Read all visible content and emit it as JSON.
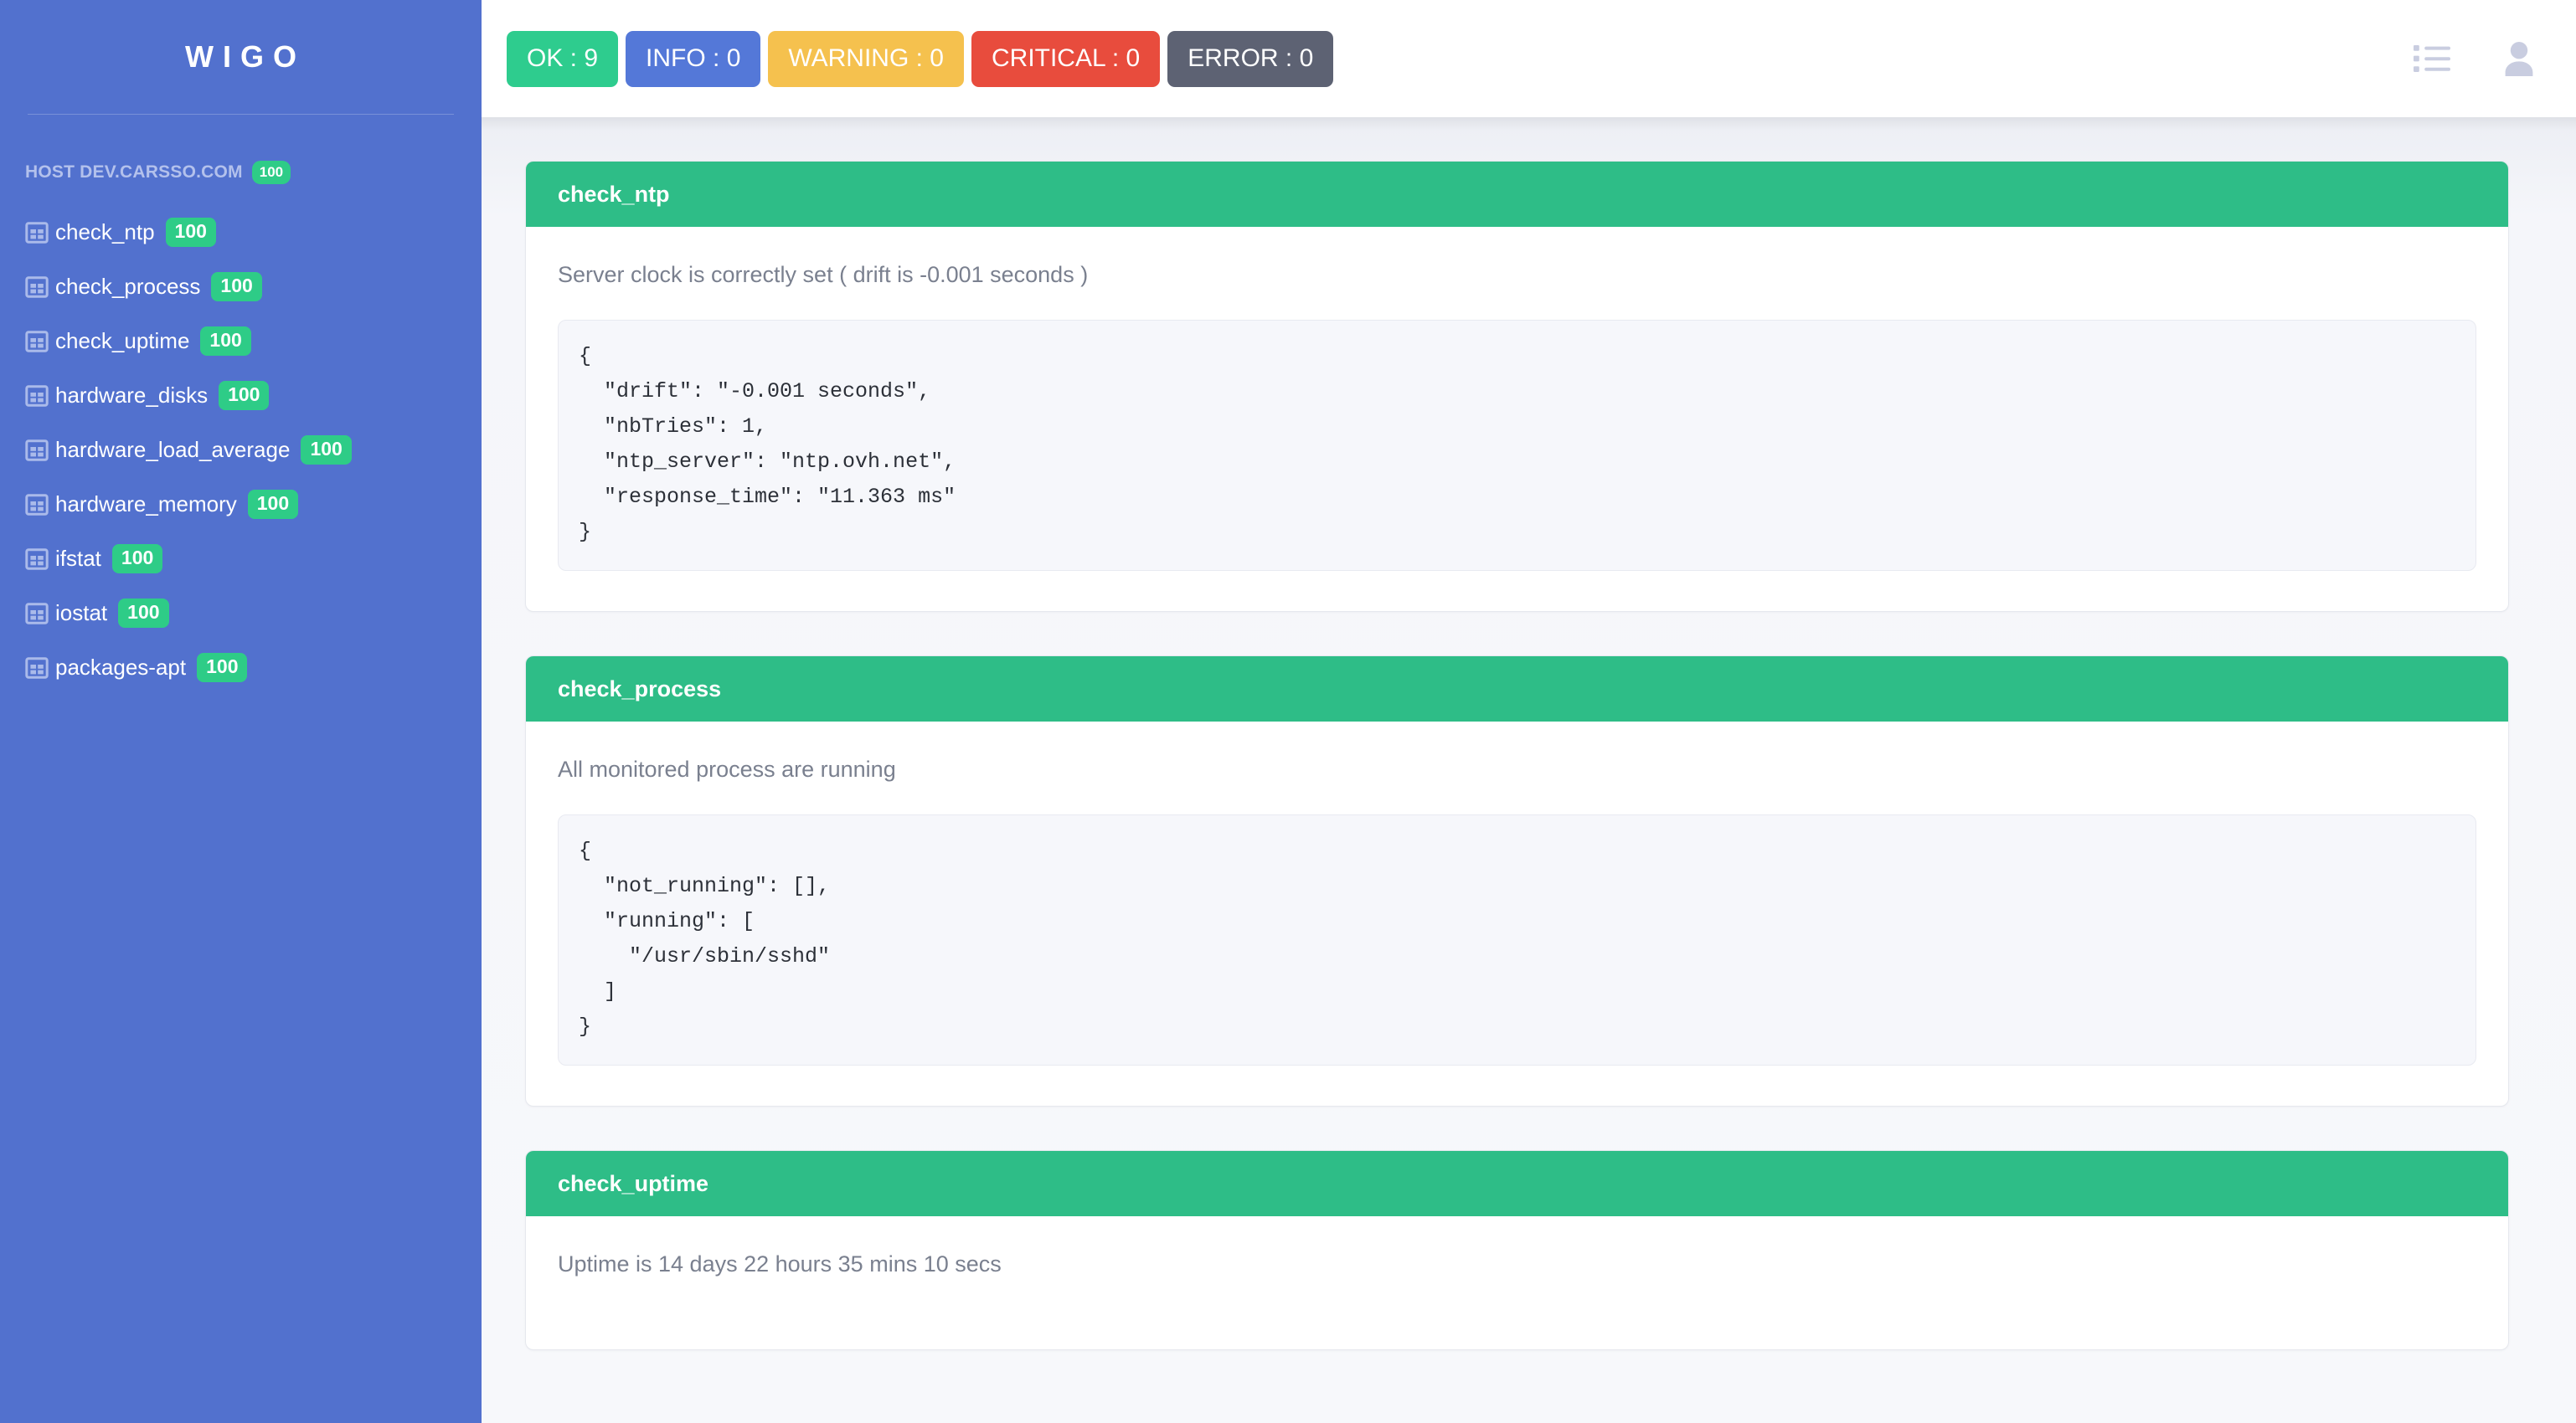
{
  "sidebar": {
    "brand": "WIGO",
    "host": {
      "label": "HOST DEV.CARSSO.COM",
      "score": "100"
    },
    "items": [
      {
        "icon": "table-icon",
        "label": "check_ntp",
        "score": "100"
      },
      {
        "icon": "table-icon",
        "label": "check_process",
        "score": "100"
      },
      {
        "icon": "table-icon",
        "label": "check_uptime",
        "score": "100"
      },
      {
        "icon": "table-icon",
        "label": "hardware_disks",
        "score": "100"
      },
      {
        "icon": "table-icon",
        "label": "hardware_load_average",
        "score": "100"
      },
      {
        "icon": "table-icon",
        "label": "hardware_memory",
        "score": "100"
      },
      {
        "icon": "table-icon",
        "label": "ifstat",
        "score": "100"
      },
      {
        "icon": "table-icon",
        "label": "iostat",
        "score": "100"
      },
      {
        "icon": "table-icon",
        "label": "packages-apt",
        "score": "100"
      }
    ]
  },
  "topbar": {
    "status_buttons": [
      {
        "label": "OK : 9",
        "color": "#2ecc8e"
      },
      {
        "label": "INFO : 0",
        "color": "#5478d8"
      },
      {
        "label": "WARNING : 0",
        "color": "#f5c14e"
      },
      {
        "label": "CRITICAL : 0",
        "color": "#e84c3d"
      },
      {
        "label": "ERROR : 0",
        "color": "#5d6273"
      }
    ],
    "icons": [
      {
        "name": "list-icon"
      },
      {
        "name": "user-icon"
      }
    ]
  },
  "main": {
    "cards": [
      {
        "title": "check_ntp",
        "status": "ok",
        "message": "Server clock is correctly set ( drift is -0.001 seconds )",
        "details": "{\n  \"drift\": \"-0.001 seconds\",\n  \"nbTries\": 1,\n  \"ntp_server\": \"ntp.ovh.net\",\n  \"response_time\": \"11.363 ms\"\n}"
      },
      {
        "title": "check_process",
        "status": "ok",
        "message": "All monitored process are running",
        "details": "{\n  \"not_running\": [],\n  \"running\": [\n    \"/usr/sbin/sshd\"\n  ]\n}"
      },
      {
        "title": "check_uptime",
        "status": "ok",
        "message": "Uptime is 14 days 22 hours 35 mins 10 secs",
        "details": ""
      }
    ]
  },
  "colors": {
    "sidebar_bg": "#5271ce",
    "accent_green": "#2ebd87",
    "badge_green": "#2ecc87",
    "content_bg": "#f5f6fa"
  }
}
